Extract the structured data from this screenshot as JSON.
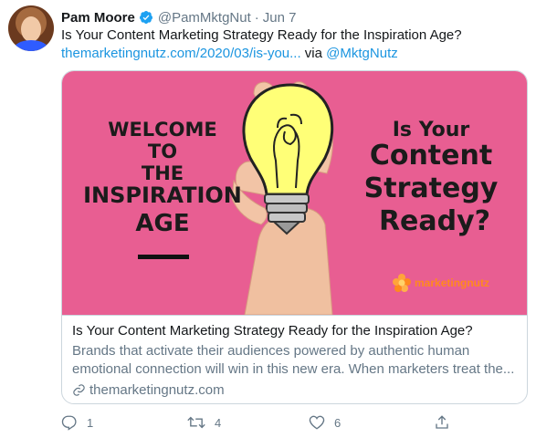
{
  "tweet": {
    "name": "Pam Moore",
    "handle": "@PamMktgNut",
    "separator": "·",
    "date": "Jun 7",
    "text_line1": "Is Your Content Marketing Strategy Ready for the Inspiration Age?",
    "link_text": "themarketingnutz.com/2020/03/is-you...",
    "via": " via ",
    "mention": "@MktgNutz"
  },
  "card": {
    "image": {
      "left_lines": [
        "WELCOME",
        "TO",
        "THE",
        "INSPIRATION",
        "AGE"
      ],
      "right_lines": [
        "Is Your",
        "Content",
        "Strategy",
        "Ready?"
      ],
      "brand": "marketingnutz"
    },
    "title": "Is Your Content Marketing Strategy Ready for the Inspiration Age?",
    "desc_line1": "Brands that activate their audiences powered by authentic human",
    "desc_line2": "emotional connection will win in this new era. When marketers treat the...",
    "domain": "themarketingnutz.com"
  },
  "actions": {
    "reply_count": "1",
    "retweet_count": "4",
    "like_count": "6"
  },
  "icons": [
    "verified-badge-icon",
    "link-icon",
    "reply-icon",
    "retweet-icon",
    "like-icon",
    "share-icon"
  ],
  "colors": {
    "accent": "#1b95e0",
    "muted": "#657786",
    "card_bg": "#e85e92"
  }
}
